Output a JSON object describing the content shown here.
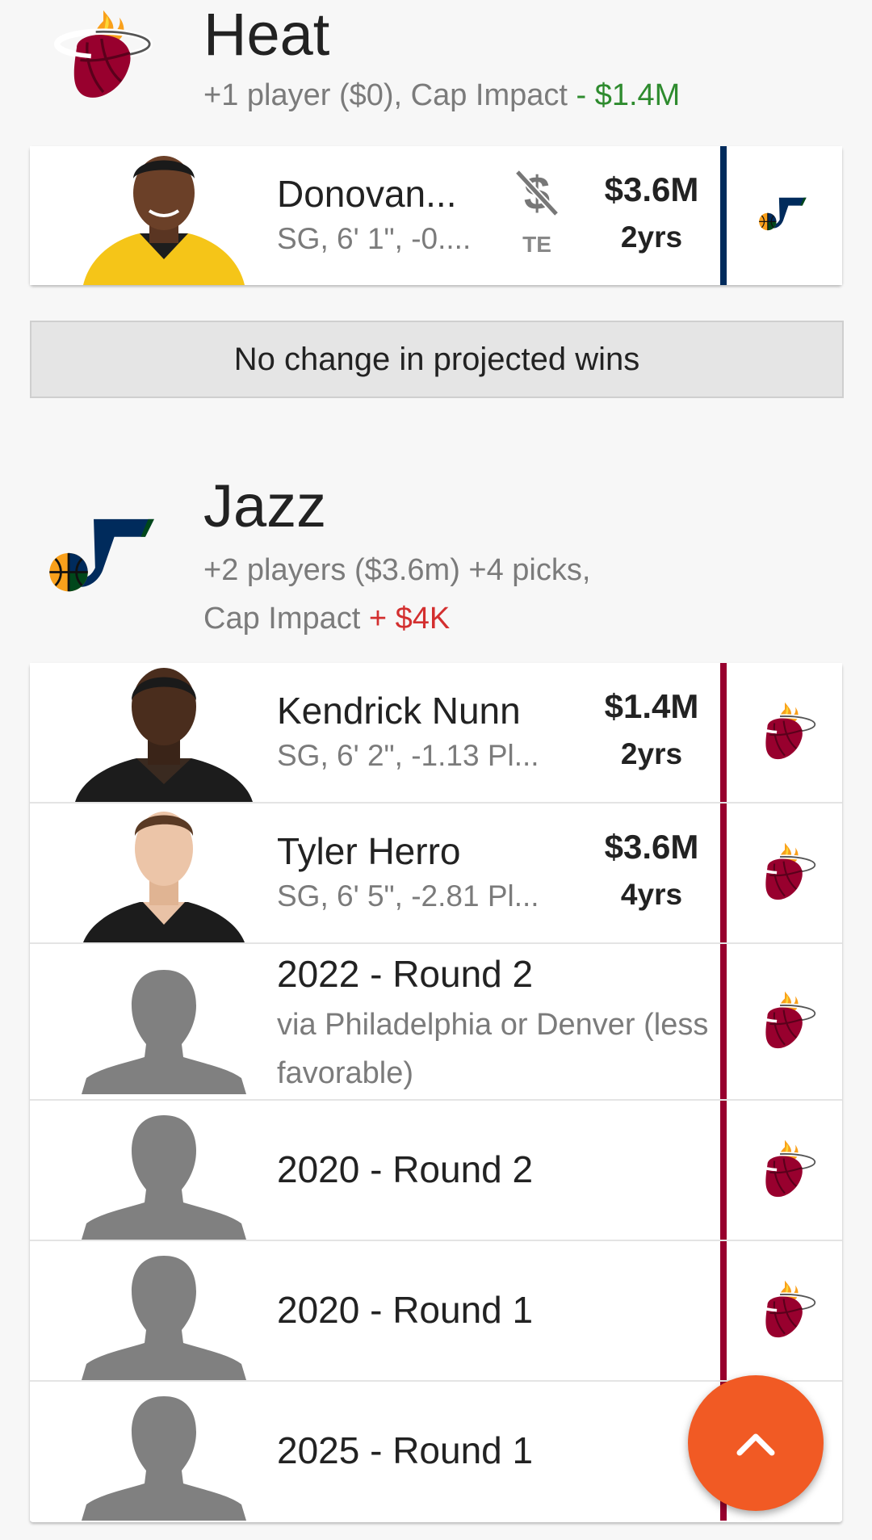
{
  "heat_section": {
    "team_name": "Heat",
    "summary_prefix": "+1 player ($0), Cap Impact",
    "cap_impact": "- $1.4M",
    "cap_impact_color": "#2e8b2e",
    "team_color": "#98002e",
    "incoming": [
      {
        "name": "Donovan...",
        "info": "SG, 6' 1\", -0....",
        "exception_icon": "no-money-icon",
        "exception_label": "TE",
        "salary": "$3.6M",
        "years": "2yrs",
        "from_team_logo": "jazz-logo",
        "from_team_color": "#002b5c"
      }
    ]
  },
  "projected_wins": "No change in projected wins",
  "jazz_section": {
    "team_name": "Jazz",
    "summary_line1": "+2 players ($3.6m) +4 picks,",
    "summary_prefix": "Cap Impact",
    "cap_impact": "+ $4K",
    "cap_impact_color": "#d32f2f",
    "incoming": [
      {
        "name": "Kendrick Nunn",
        "info": "SG, 6' 2\", -1.13 Pl...",
        "salary": "$1.4M",
        "years": "2yrs",
        "from_team_logo": "heat-logo"
      },
      {
        "name": "Tyler Herro",
        "info": "SG, 6' 5\", -2.81 Pl...",
        "salary": "$3.6M",
        "years": "4yrs",
        "from_team_logo": "heat-logo"
      }
    ],
    "picks": [
      {
        "title": "2022 - Round 2",
        "detail": "via Philadelphia or Denver (less favorable)"
      },
      {
        "title": "2020 - Round 2"
      },
      {
        "title": "2020 - Round 1"
      },
      {
        "title": "2025 - Round 1"
      }
    ]
  },
  "fab_icon": "chevron-up-icon"
}
